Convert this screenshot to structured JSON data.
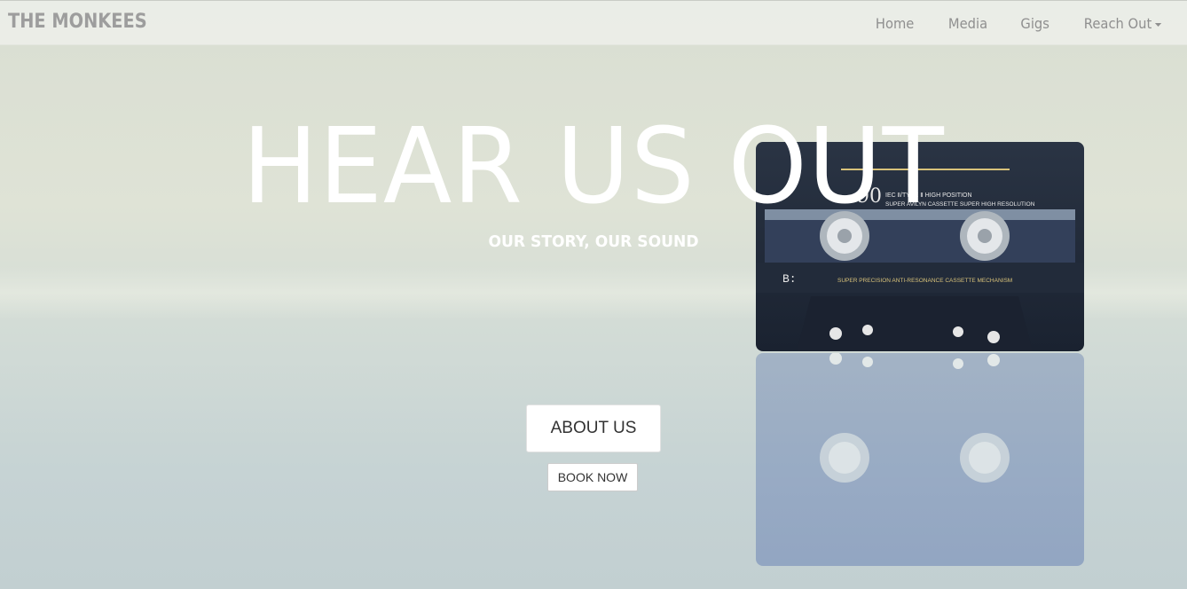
{
  "navbar": {
    "brand": "THE MONKEES",
    "items": [
      {
        "label": "Home"
      },
      {
        "label": "Media"
      },
      {
        "label": "Gigs"
      },
      {
        "label": "Reach Out",
        "dropdown": true
      }
    ]
  },
  "hero": {
    "title": "HEAR US OUT",
    "subtitle": "OUR STORY, OUR SOUND",
    "primary_button": "ABOUT US",
    "secondary_button": "BOOK NOW"
  },
  "cassette": {
    "number": "90",
    "type_text": "IEC Ⅱ/TYPE Ⅱ  HIGH POSITION",
    "tagline": "SUPER AVILYN CASSETTE SUPER HIGH RESOLUTION",
    "side": "B:",
    "mechanism_text": "SUPER PRECISION ANTI-RESONANCE CASSETTE MECHANISM"
  },
  "colors": {
    "nav_text": "#8f8f8f",
    "brand_text": "#9d9d9d",
    "hero_text": "#ffffff",
    "cassette_body": "#1f2735"
  }
}
